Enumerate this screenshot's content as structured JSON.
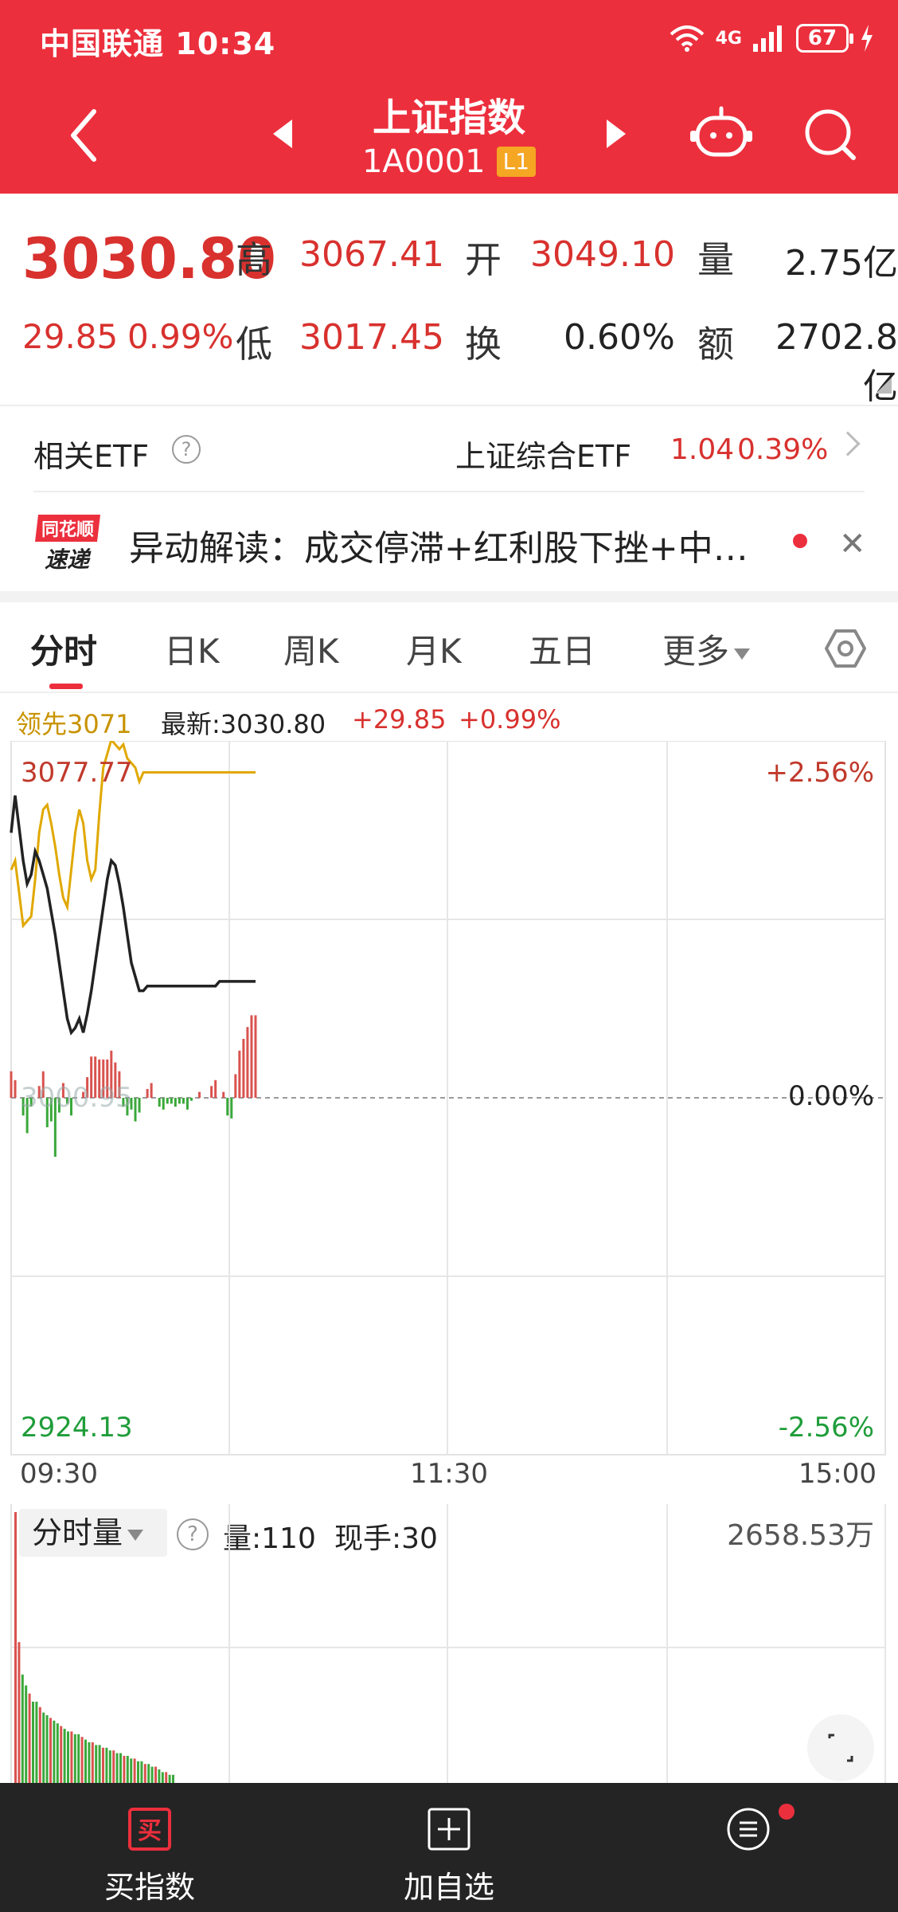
{
  "status_bar": {
    "carrier": "中国联通",
    "time": "10:34",
    "network": "4G",
    "battery": "67"
  },
  "header": {
    "title": "上证指数",
    "code": "1A0001",
    "level_badge": "L1"
  },
  "quote": {
    "price": "3030.80",
    "change": "29.85",
    "change_pct": "0.99%",
    "high_label": "高",
    "high": "3067.41",
    "low_label": "低",
    "low": "3017.45",
    "open_label": "开",
    "open": "3049.10",
    "turnover_label": "换",
    "turnover": "0.60%",
    "volume_label": "量",
    "volume": "2.75亿",
    "amount_label": "额",
    "amount": "2702.8亿"
  },
  "etf": {
    "label": "相关ETF",
    "name": "上证综合ETF",
    "value": "1.04",
    "pct": "0.39%"
  },
  "news": {
    "logo_top": "同花顺",
    "logo_bottom": "速递",
    "text": "异动解读：成交停滞+红利股下挫+中…"
  },
  "tabs": [
    {
      "label": "分时"
    },
    {
      "label": "日K"
    },
    {
      "label": "周K"
    },
    {
      "label": "月K"
    },
    {
      "label": "五日"
    },
    {
      "label": "更多"
    }
  ],
  "legend": {
    "leader": "领先3071",
    "latest": "最新:3030.80",
    "change": "+29.85",
    "pct": "+0.99%"
  },
  "colors": {
    "red": "#ec2f3d",
    "price_red": "#d8312e",
    "green": "#1f9d3a",
    "leader_yellow": "#e0a800",
    "bar_red": "#d9534f",
    "bar_green": "#3aa83a"
  },
  "chart_data": {
    "type": "line",
    "y_left_top": "3077.77",
    "y_left_mid": "3000.95",
    "y_left_bottom": "2924.13",
    "y_right_top": "+2.56%",
    "y_right_mid": "0.00%",
    "y_right_bottom": "-2.56%",
    "x_ticks": [
      "09:30",
      "11:30",
      "15:00"
    ],
    "prev_close": 3000.95,
    "ylim": [
      2924.13,
      3077.77
    ],
    "price_series": [
      3058,
      3066,
      3059,
      3052,
      3047,
      3049,
      3054,
      3052,
      3049,
      3046,
      3041,
      3036,
      3030,
      3024,
      3018,
      3015,
      3016,
      3018,
      3015,
      3019,
      3024,
      3030,
      3036,
      3042,
      3048,
      3052,
      3051,
      3047,
      3042,
      3036,
      3030,
      3027,
      3024,
      3024,
      3025,
      3025,
      3025,
      3025,
      3025,
      3025,
      3025,
      3025,
      3025,
      3025,
      3025,
      3025,
      3025,
      3025,
      3025,
      3025,
      3025,
      3025,
      3026,
      3026,
      3026,
      3026,
      3026,
      3026,
      3026,
      3026,
      3026,
      3026
    ],
    "leader_series": [
      3050,
      3052,
      3045,
      3038,
      3039,
      3040,
      3048,
      3058,
      3063,
      3064,
      3060,
      3055,
      3049,
      3044,
      3042,
      3050,
      3058,
      3063,
      3060,
      3052,
      3048,
      3050,
      3062,
      3072,
      3075,
      3078,
      3077,
      3076,
      3077,
      3074,
      3073,
      3072,
      3069,
      3071,
      3071,
      3071,
      3071,
      3071,
      3071,
      3071,
      3071,
      3071,
      3071,
      3071,
      3071,
      3071,
      3071,
      3071,
      3071,
      3071,
      3071,
      3071,
      3071,
      3071,
      3071,
      3071,
      3071,
      3071,
      3071,
      3071,
      3071,
      3071
    ],
    "diff_bars": [
      0.9,
      0.6,
      0.0,
      -0.6,
      -1.2,
      -0.3,
      0.0,
      0.4,
      0.9,
      -1.0,
      -0.8,
      -2.0,
      -0.5,
      0.5,
      -0.2,
      -0.6,
      0.0,
      0.0,
      0.2,
      0.7,
      1.4,
      1.4,
      1.3,
      1.3,
      1.3,
      1.6,
      1.2,
      0.9,
      -0.3,
      -0.6,
      -0.4,
      -0.8,
      -0.5,
      0.0,
      0.3,
      0.5,
      0.0,
      -0.3,
      -0.4,
      -0.2,
      -0.2,
      -0.3,
      -0.2,
      -0.2,
      -0.4,
      -0.1,
      0.0,
      0.2,
      0.0,
      0.0,
      0.4,
      0.6,
      0.0,
      0.2,
      -0.6,
      -0.7,
      0.8,
      1.6,
      2.0,
      2.4,
      2.8,
      2.8
    ]
  },
  "volume_panel": {
    "selector": "分时量",
    "volume_text": "量:110",
    "current_hand": "现手:30",
    "max_label": "2658.53万",
    "bars": [
      100,
      52,
      40,
      36,
      33,
      30,
      30,
      28,
      26,
      25,
      24,
      23,
      22,
      21,
      20,
      19,
      19,
      18,
      18,
      17,
      16,
      15,
      15,
      14,
      14,
      13,
      13,
      12,
      12,
      11,
      11,
      10,
      10,
      9,
      9,
      8,
      8,
      7,
      7,
      6,
      6,
      5,
      4,
      4,
      3,
      3
    ]
  },
  "bottom_bar": {
    "buy": "买指数",
    "buy_icon": "买",
    "add": "加自选",
    "more": ""
  }
}
